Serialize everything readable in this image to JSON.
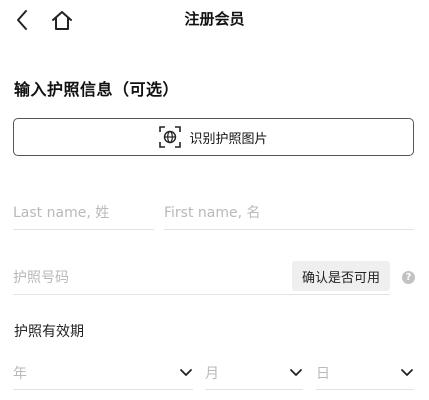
{
  "header": {
    "title": "注册会员",
    "back_icon": "chevron-left-icon",
    "home_icon": "home-icon"
  },
  "section": {
    "title": "输入护照信息（可选）"
  },
  "scan_button": {
    "label": "识别护照图片",
    "icon": "scan-passport-icon"
  },
  "form": {
    "last_name_placeholder": "Last name, 姓",
    "first_name_placeholder": "First name, 名",
    "passport_placeholder": "护照号码",
    "verify_label": "确认是否可用",
    "help_icon": "question-icon",
    "expiry_label": "护照有效期",
    "year_placeholder": "年",
    "month_placeholder": "月",
    "day_placeholder": "日"
  }
}
